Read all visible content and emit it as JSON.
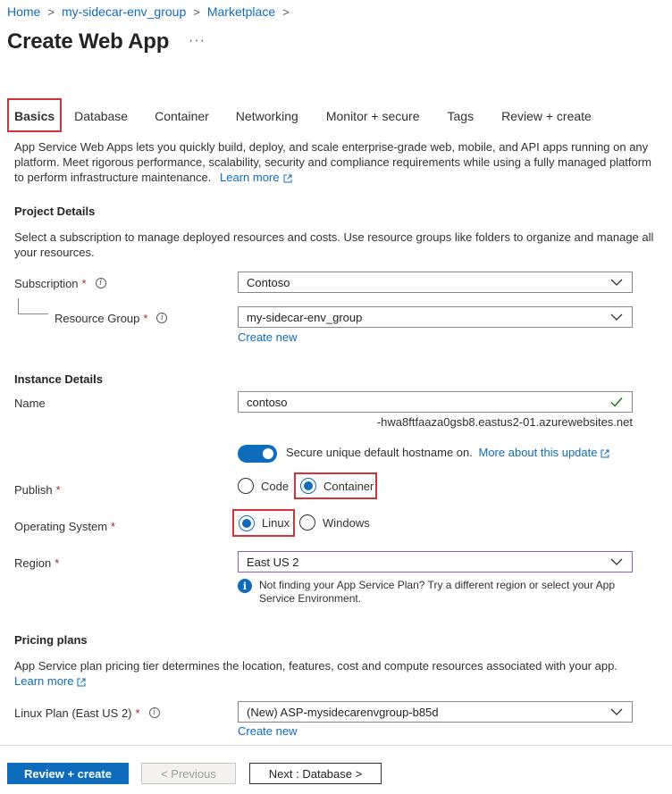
{
  "breadcrumb": [
    "Home",
    "my-sidecar-env_group",
    "Marketplace"
  ],
  "page_title": "Create Web App",
  "more_label": "···",
  "tabs": [
    "Basics",
    "Database",
    "Container",
    "Networking",
    "Monitor + secure",
    "Tags",
    "Review + create"
  ],
  "intro": {
    "text": "App Service Web Apps lets you quickly build, deploy, and scale enterprise-grade web, mobile, and API apps running on any platform. Meet rigorous performance, scalability, security and compliance requirements while using a fully managed platform to perform infrastructure maintenance.",
    "learn_more": "Learn more"
  },
  "project": {
    "title": "Project Details",
    "desc": "Select a subscription to manage deployed resources and costs. Use resource groups like folders to organize and manage all your resources.",
    "subscription_label": "Subscription",
    "subscription_value": "Contoso",
    "resource_group_label": "Resource Group",
    "resource_group_value": "my-sidecar-env_group",
    "create_new": "Create new"
  },
  "instance": {
    "title": "Instance Details",
    "name_label": "Name",
    "name_value": "contoso",
    "hostname_suffix": "-hwa8ftfaaza0gsb8.eastus2-01.azurewebsites.net",
    "secure_hostname_text": "Secure unique default hostname on.",
    "secure_hostname_link": "More about this update",
    "publish_label": "Publish",
    "publish_options": [
      "Code",
      "Container"
    ],
    "os_label": "Operating System",
    "os_options": [
      "Linux",
      "Windows"
    ],
    "region_label": "Region",
    "region_value": "East US 2",
    "region_info": "Not finding your App Service Plan? Try a different region or select your App Service Environment."
  },
  "pricing": {
    "title": "Pricing plans",
    "desc": "App Service plan pricing tier determines the location, features, cost and compute resources associated with your app.",
    "learn_more": "Learn more",
    "plan_label": "Linux Plan (East US 2)",
    "plan_value": "(New) ASP-mysidecarenvgroup-b85d",
    "create_new": "Create new"
  },
  "footer": {
    "review_create": "Review + create",
    "previous": "< Previous",
    "next": "Next : Database >"
  },
  "required_mark": "*",
  "colors": {
    "accent": "#0f6cbd",
    "highlight": "#d13438",
    "valid": "#107c10"
  }
}
